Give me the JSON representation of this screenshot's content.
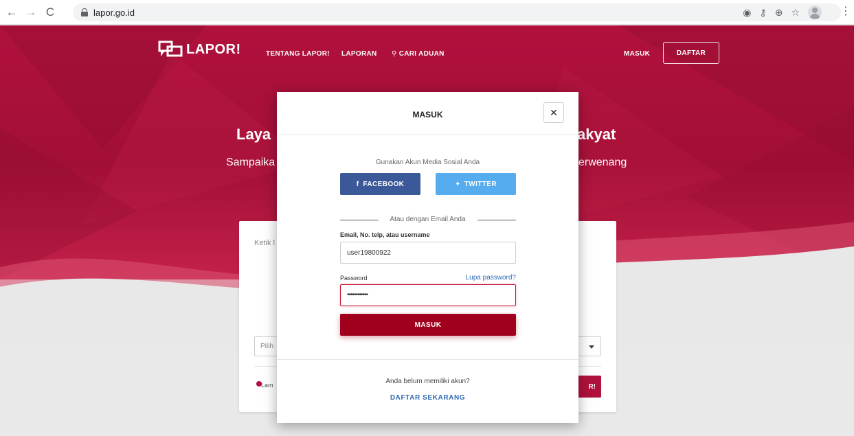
{
  "browser": {
    "url": "lapor.go.id",
    "icons": [
      "back-icon",
      "forward-icon",
      "reload-icon",
      "lock-icon",
      "location-icon",
      "key-icon",
      "zoom-icon",
      "star-icon",
      "profile-icon",
      "kebab-menu-icon"
    ]
  },
  "navbar": {
    "logo_text": "LAPOR!",
    "links": {
      "tentang": "TENTANG LAPOR!",
      "laporan": "LAPORAN",
      "cari": "CARI ADUAN"
    },
    "masuk": "MASUK",
    "daftar": "DAFTAR"
  },
  "hero": {
    "title_left": "Laya",
    "title_right": "akyat",
    "subtitle_left": "Sampaika",
    "subtitle_right": "erwenang"
  },
  "card": {
    "hint": "Ketik l",
    "select_placeholder": "Pilih",
    "small_text": "Lam",
    "submit_fragment": "R!"
  },
  "modal": {
    "title": "MASUK",
    "close_symbol": "✕",
    "social_caption": "Gunakan Akun Media Sosial Anda",
    "facebook": {
      "icon": "f",
      "label": "FACEBOOK"
    },
    "twitter": {
      "icon": "✦",
      "label": "TWITTER"
    },
    "or_text": "Atau dengan Email Anda",
    "email_label": "Email, No. telp, atau username",
    "email_value": "user19800922",
    "password_label": "Password",
    "forgot_link": "Lupa password?",
    "password_masked": "••••••••••••",
    "submit": "MASUK",
    "footer_text": "Anda belum memiliki akun?",
    "footer_link": "DAFTAR SEKARANG"
  },
  "colors": {
    "brand_red": "#b0113d",
    "submit_red": "#a0001c",
    "facebook_blue": "#3b5998",
    "twitter_blue": "#55acee",
    "link_blue": "#2c6bb5",
    "error_border": "#c4102c"
  }
}
